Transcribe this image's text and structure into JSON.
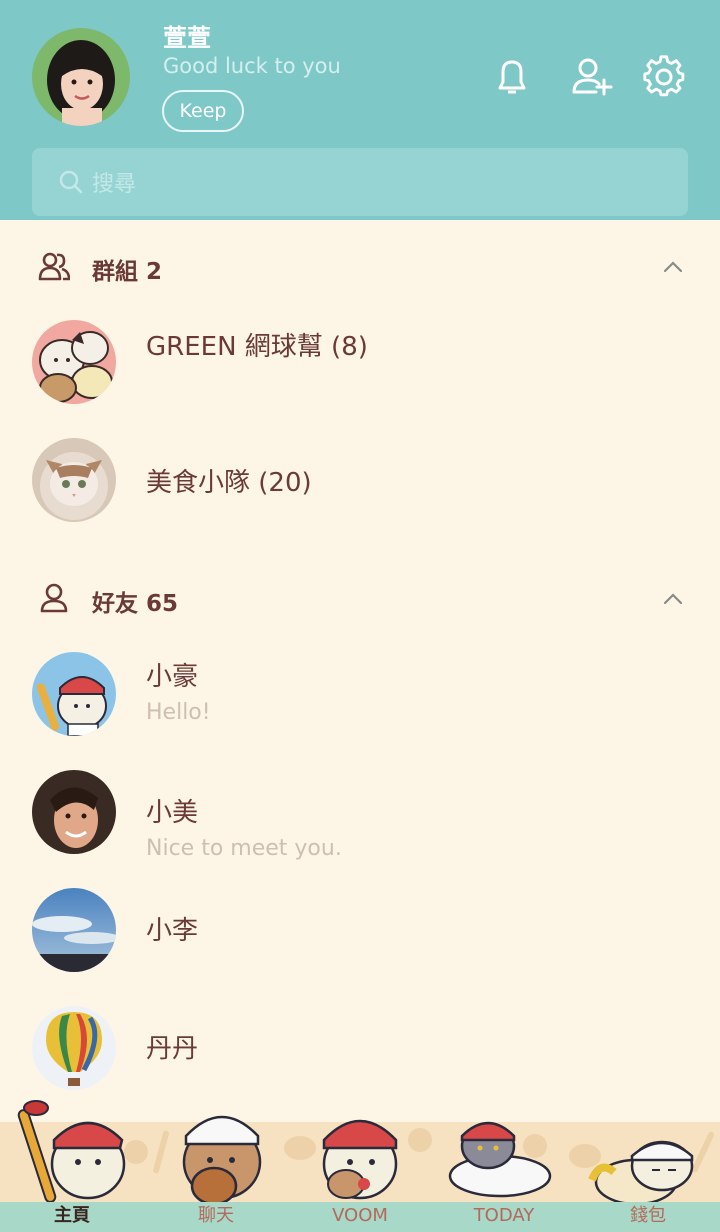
{
  "profile": {
    "name": "萱萱",
    "status": "Good luck to you",
    "keep_label": "Keep"
  },
  "search": {
    "placeholder": "搜尋"
  },
  "groups": {
    "title": "群組 2",
    "items": [
      {
        "name": "GREEN 網球幫 (8)"
      },
      {
        "name": "美食小隊 (20)"
      }
    ]
  },
  "friends": {
    "title": "好友 65",
    "items": [
      {
        "name": "小豪",
        "status": "Hello!"
      },
      {
        "name": "小美",
        "status": "Nice to meet you."
      },
      {
        "name": "小李",
        "status": ""
      },
      {
        "name": "丹丹",
        "status": ""
      }
    ]
  },
  "tabs": [
    {
      "label": "主頁",
      "active": true
    },
    {
      "label": "聊天",
      "active": false
    },
    {
      "label": "VOOM",
      "active": false
    },
    {
      "label": "TODAY",
      "active": false
    },
    {
      "label": "錢包",
      "active": false
    }
  ],
  "colors": {
    "header": "#7ec8c8",
    "background": "#fdf6e6",
    "text_primary": "#6b3a36",
    "text_secondary": "#cdbfb2",
    "tab_bar": "#a8d8c8"
  }
}
